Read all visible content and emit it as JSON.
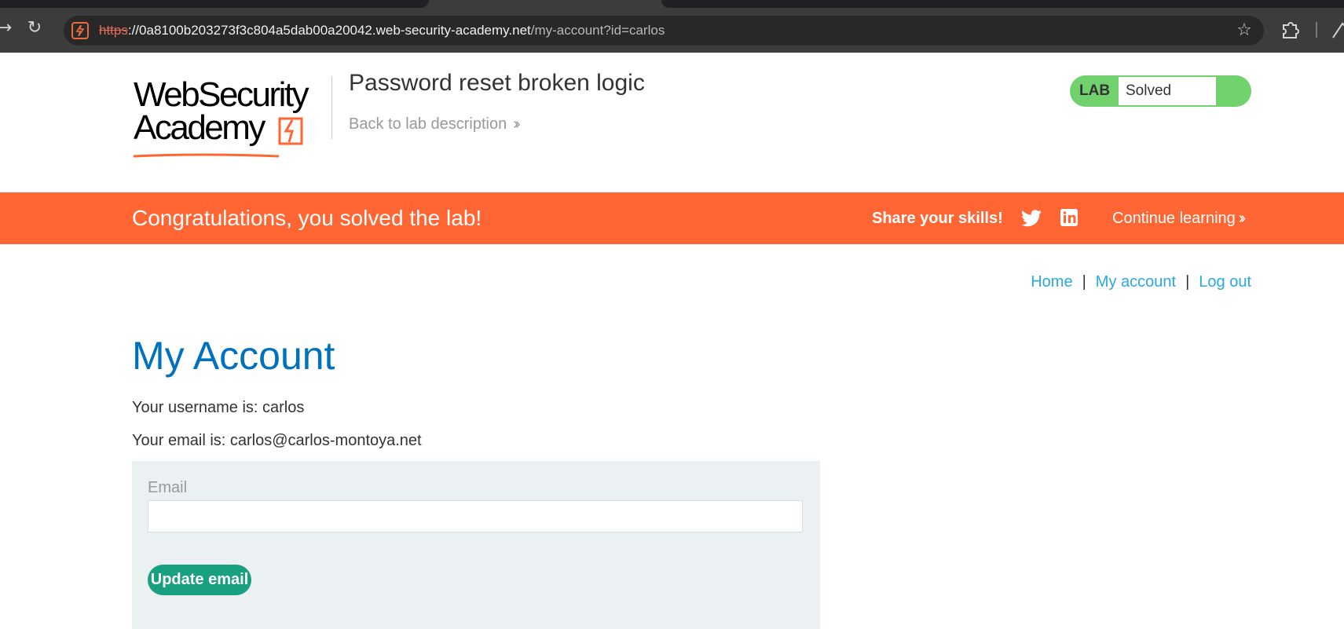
{
  "browser": {
    "url_scheme": "https",
    "url_host": "://0a8100b203273f3c804a5dab00a20042.web-security-academy.net",
    "url_path": "/my-account?id=carlos"
  },
  "header": {
    "logo_line1": "WebSecurity",
    "logo_line2": "Academy",
    "lab_title": "Password reset broken logic",
    "back_link": "Back to lab description",
    "status_label": "LAB",
    "status_value": "Solved"
  },
  "banner": {
    "message": "Congratulations, you solved the lab!",
    "share_label": "Share your skills!",
    "continue_label": "Continue learning"
  },
  "nav": {
    "home": "Home",
    "my_account": "My account",
    "log_out": "Log out",
    "separator": "|"
  },
  "account": {
    "heading": "My Account",
    "username_line": "Your username is: carlos",
    "email_line": "Your email is: carlos@carlos-montoya.net",
    "email_label": "Email",
    "email_value": "",
    "update_button": "Update email"
  },
  "colors": {
    "accent_orange": "#ff6633",
    "heading_blue": "#0071bc",
    "link_blue": "#29a9e1",
    "solved_green": "#70d16d",
    "button_green": "#18a081"
  },
  "icons": [
    "forward-icon",
    "reload-icon",
    "site-favicon-icon",
    "star-icon",
    "extensions-icon",
    "profile-icon",
    "twitter-icon",
    "linkedin-icon"
  ]
}
